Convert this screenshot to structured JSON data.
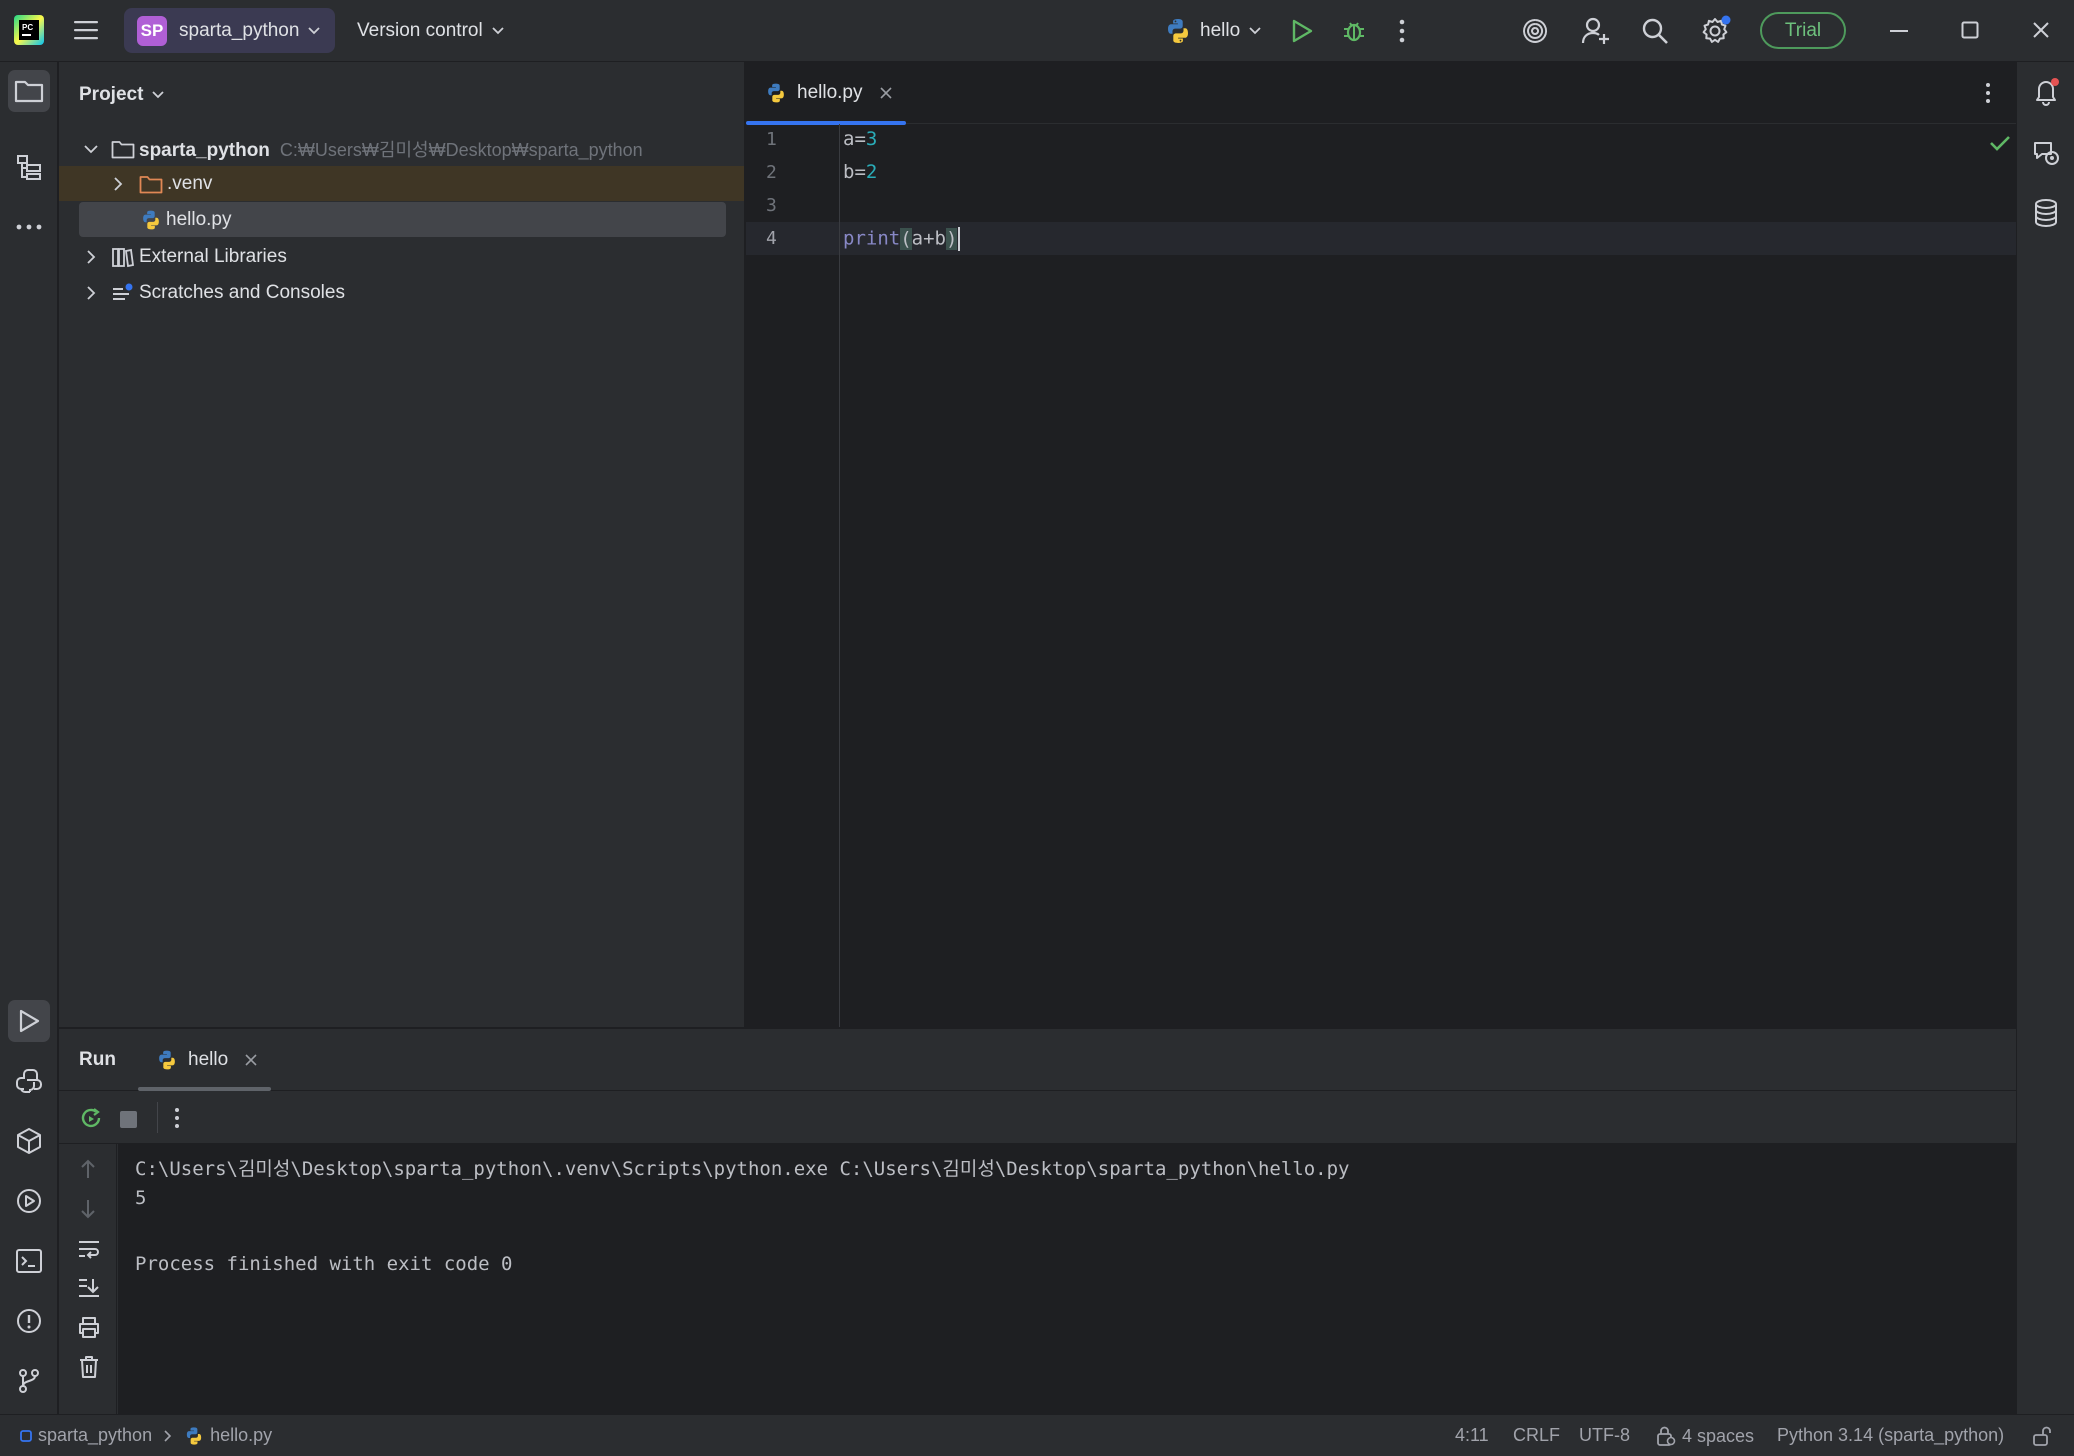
{
  "titlebar": {
    "project_badge": "SP",
    "project_name": "sparta_python",
    "vcs_label": "Version control",
    "run_config": "hello",
    "trial_label": "Trial"
  },
  "project_panel": {
    "header": "Project",
    "root": {
      "name": "sparta_python",
      "path": "C:₩Users₩김미성₩Desktop₩sparta_python"
    },
    "items": [
      {
        "label": ".venv"
      },
      {
        "label": "hello.py"
      },
      {
        "label": "External Libraries"
      },
      {
        "label": "Scratches and Consoles"
      }
    ]
  },
  "editor": {
    "tab_label": "hello.py",
    "line_numbers": [
      "1",
      "2",
      "3",
      "4"
    ],
    "code": {
      "l1_var": "a=",
      "l1_val": "3",
      "l2_var": "b=",
      "l2_val": "2",
      "l4_fn": "print",
      "l4_open": "(",
      "l4_args": "a+b",
      "l4_close": ")"
    }
  },
  "run_panel": {
    "title": "Run",
    "tab_label": "hello",
    "output": [
      "C:\\Users\\김미성\\Desktop\\sparta_python\\.venv\\Scripts\\python.exe C:\\Users\\김미성\\Desktop\\sparta_python\\hello.py",
      "5",
      "",
      "Process finished with exit code 0"
    ]
  },
  "statusbar": {
    "breadcrumb_project": "sparta_python",
    "breadcrumb_file": "hello.py",
    "position": "4:11",
    "line_endings": "CRLF",
    "encoding": "UTF-8",
    "indent": "4 spaces",
    "interpreter": "Python 3.14 (sparta_python)"
  },
  "colors": {
    "accent": "#3574f0",
    "trial_green": "#6ec17d",
    "badge_purple": "#b05fd6"
  }
}
